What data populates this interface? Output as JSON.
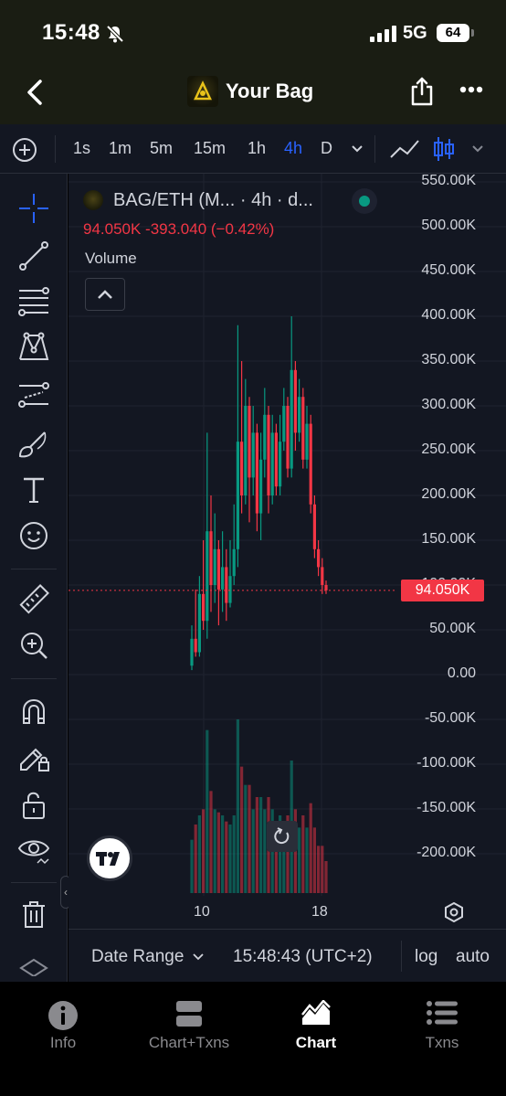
{
  "status_bar": {
    "time": "15:48",
    "network": "5G",
    "battery": "64"
  },
  "header": {
    "title": "Your Bag"
  },
  "toolbar": {
    "intervals": [
      "1s",
      "1m",
      "5m",
      "15m",
      "1h",
      "4h",
      "D"
    ],
    "active_interval": "4h"
  },
  "legend": {
    "symbol": "BAG/ETH (M... · 4h · d...",
    "ohlc": "94.050K  -393.040 (−0.42%)",
    "volume_label": "Volume",
    "status_color": "#089981"
  },
  "price_axis": {
    "labels": [
      "550.00K",
      "500.00K",
      "450.00K",
      "400.00K",
      "350.00K",
      "300.00K",
      "250.00K",
      "200.00K",
      "150.00K",
      "100.00K",
      "50.00K",
      "0.00",
      "-50.00K",
      "-100.00K",
      "-150.00K",
      "-200.00K"
    ],
    "last_price": "94.050K"
  },
  "time_axis": {
    "labels": [
      "10",
      "18"
    ]
  },
  "bottom_bar": {
    "date_range": "Date Range",
    "time": "15:48:43 (UTC+2)",
    "log": "log",
    "auto": "auto"
  },
  "tabs": [
    {
      "label": "Info",
      "icon": "info-icon"
    },
    {
      "label": "Chart+Txns",
      "icon": "chart-txns-icon"
    },
    {
      "label": "Chart",
      "icon": "chart-icon"
    },
    {
      "label": "Txns",
      "icon": "txns-icon"
    }
  ],
  "active_tab": "Chart",
  "colors": {
    "up": "#089981",
    "down": "#f23645",
    "accent": "#2962ff",
    "background": "#131722"
  },
  "chart_data": {
    "type": "candlestick",
    "y_range": [
      -200000,
      550000
    ],
    "last_price": 94050,
    "candles": [
      {
        "o": 10000,
        "c": 40000,
        "h": 55000,
        "l": 5000
      },
      {
        "o": 40000,
        "c": 25000,
        "h": 95000,
        "l": 20000
      },
      {
        "o": 25000,
        "c": 90000,
        "h": 110000,
        "l": 20000
      },
      {
        "o": 90000,
        "c": 60000,
        "h": 150000,
        "l": 50000
      },
      {
        "o": 60000,
        "c": 160000,
        "h": 270000,
        "l": 40000
      },
      {
        "o": 160000,
        "c": 100000,
        "h": 200000,
        "l": 70000
      },
      {
        "o": 100000,
        "c": 140000,
        "h": 180000,
        "l": 80000
      },
      {
        "o": 140000,
        "c": 95000,
        "h": 150000,
        "l": 55000
      },
      {
        "o": 95000,
        "c": 120000,
        "h": 160000,
        "l": 70000
      },
      {
        "o": 120000,
        "c": 80000,
        "h": 140000,
        "l": 60000
      },
      {
        "o": 80000,
        "c": 110000,
        "h": 150000,
        "l": 75000
      },
      {
        "o": 110000,
        "c": 140000,
        "h": 190000,
        "l": 100000
      },
      {
        "o": 140000,
        "c": 260000,
        "h": 390000,
        "l": 120000
      },
      {
        "o": 260000,
        "c": 200000,
        "h": 350000,
        "l": 180000
      },
      {
        "o": 200000,
        "c": 300000,
        "h": 330000,
        "l": 190000
      },
      {
        "o": 300000,
        "c": 220000,
        "h": 310000,
        "l": 170000
      },
      {
        "o": 220000,
        "c": 270000,
        "h": 300000,
        "l": 200000
      },
      {
        "o": 270000,
        "c": 180000,
        "h": 280000,
        "l": 160000
      },
      {
        "o": 180000,
        "c": 240000,
        "h": 270000,
        "l": 150000
      },
      {
        "o": 240000,
        "c": 290000,
        "h": 320000,
        "l": 220000
      },
      {
        "o": 290000,
        "c": 200000,
        "h": 300000,
        "l": 180000
      },
      {
        "o": 200000,
        "c": 270000,
        "h": 290000,
        "l": 190000
      },
      {
        "o": 270000,
        "c": 210000,
        "h": 280000,
        "l": 200000
      },
      {
        "o": 210000,
        "c": 260000,
        "h": 290000,
        "l": 200000
      },
      {
        "o": 260000,
        "c": 300000,
        "h": 320000,
        "l": 250000
      },
      {
        "o": 300000,
        "c": 230000,
        "h": 310000,
        "l": 220000
      },
      {
        "o": 230000,
        "c": 340000,
        "h": 400000,
        "l": 220000
      },
      {
        "o": 340000,
        "c": 270000,
        "h": 350000,
        "l": 250000
      },
      {
        "o": 270000,
        "c": 310000,
        "h": 330000,
        "l": 260000
      },
      {
        "o": 310000,
        "c": 240000,
        "h": 320000,
        "l": 230000
      },
      {
        "o": 240000,
        "c": 280000,
        "h": 300000,
        "l": 230000
      },
      {
        "o": 280000,
        "c": 190000,
        "h": 290000,
        "l": 180000
      },
      {
        "o": 190000,
        "c": 140000,
        "h": 200000,
        "l": 130000
      },
      {
        "o": 140000,
        "c": 120000,
        "h": 150000,
        "l": 110000
      },
      {
        "o": 120000,
        "c": 100000,
        "h": 130000,
        "l": 90000
      },
      {
        "o": 100000,
        "c": 94050,
        "h": 105000,
        "l": 90000
      }
    ]
  }
}
